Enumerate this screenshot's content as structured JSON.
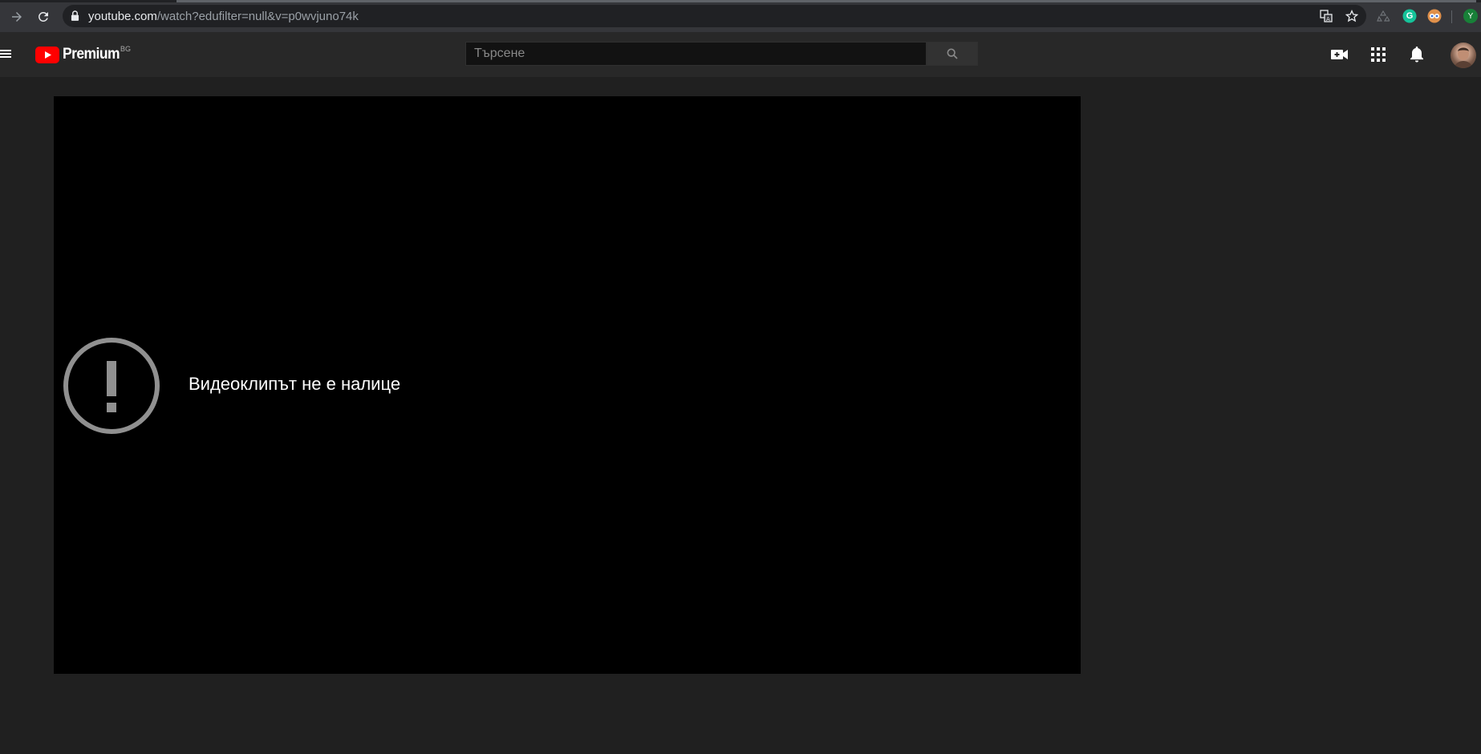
{
  "browser": {
    "url_host": "youtube.com",
    "url_path": "/watch?edufilter=null&v=p0wvjuno74k",
    "profile_initial": "Y",
    "extension_grammarly_letter": "G"
  },
  "youtube": {
    "logo_text": "Premium",
    "country_code": "BG",
    "search_placeholder": "Търсене"
  },
  "player": {
    "error_message": "Видеоклипът не е налице"
  },
  "colors": {
    "brand_red": "#ff0000",
    "page_bg": "#202020",
    "header_bg": "#282828",
    "error_icon": "#909090"
  }
}
